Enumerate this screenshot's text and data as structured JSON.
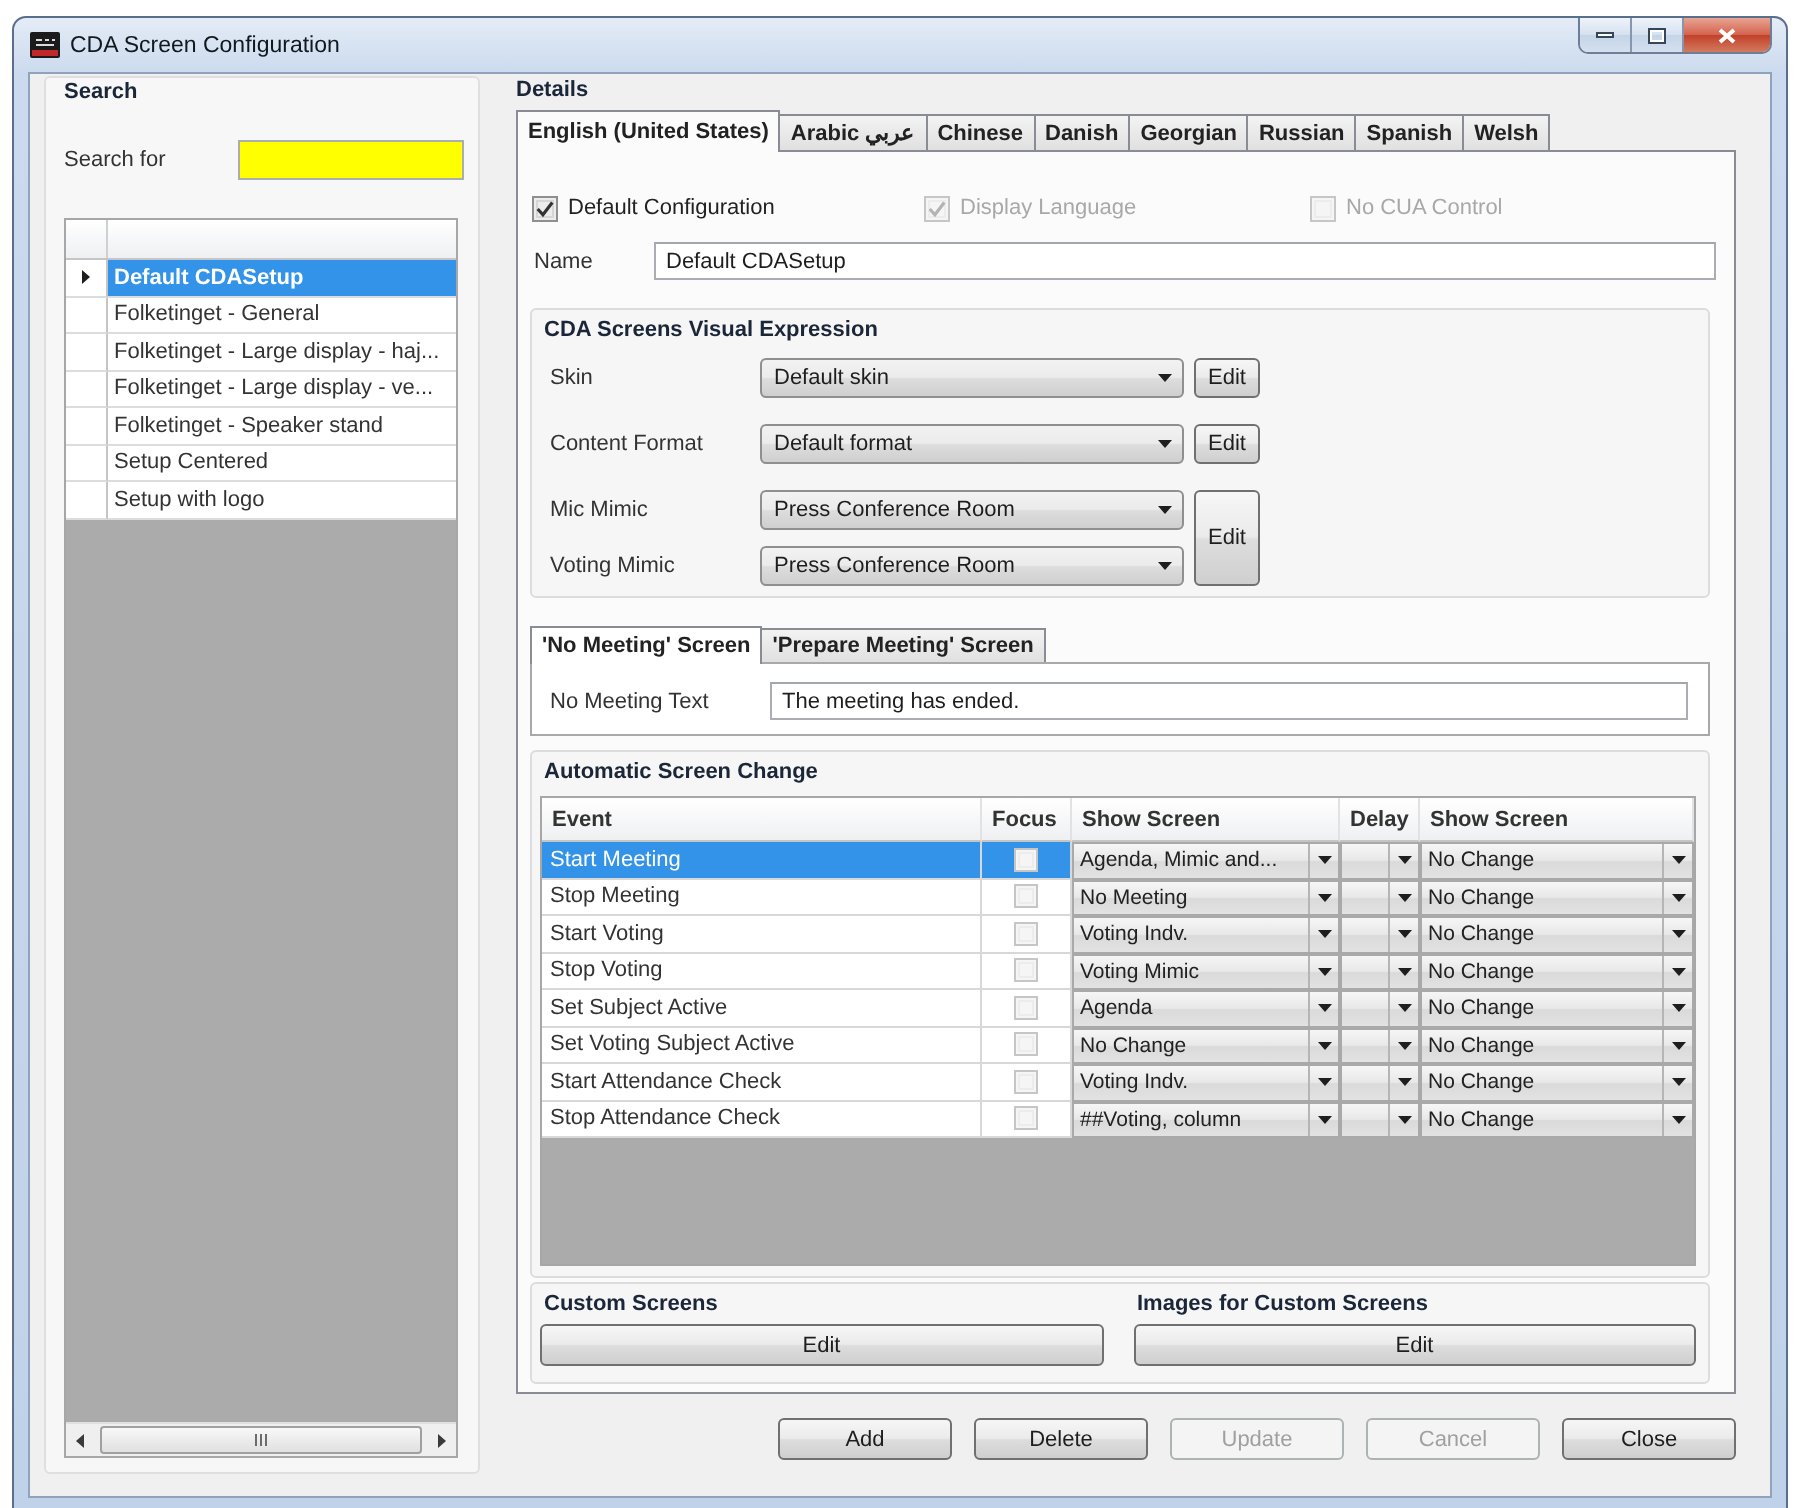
{
  "window": {
    "title": "CDA Screen Configuration"
  },
  "search": {
    "heading": "Search",
    "label": "Search for"
  },
  "setups": [
    {
      "name": "Default CDASetup",
      "selected": true
    },
    {
      "name": "Folketinget - General",
      "selected": false
    },
    {
      "name": "Folketinget - Large display - haj...",
      "selected": false
    },
    {
      "name": "Folketinget - Large display - ve...",
      "selected": false
    },
    {
      "name": "Folketinget - Speaker stand",
      "selected": false
    },
    {
      "name": "Setup Centered",
      "selected": false
    },
    {
      "name": "Setup with logo",
      "selected": false
    }
  ],
  "details": {
    "heading": "Details",
    "tabs": [
      {
        "label": "English (United States)",
        "selected": true
      },
      {
        "label": "Arabic عربي",
        "selected": false
      },
      {
        "label": "Chinese",
        "selected": false
      },
      {
        "label": "Danish",
        "selected": false
      },
      {
        "label": "Georgian",
        "selected": false
      },
      {
        "label": "Russian",
        "selected": false
      },
      {
        "label": "Spanish",
        "selected": false
      },
      {
        "label": "Welsh",
        "selected": false
      }
    ],
    "options": [
      {
        "label": "Default Configuration",
        "checked": true,
        "disabled": false
      },
      {
        "label": "Display Language",
        "checked": true,
        "disabled": true
      },
      {
        "label": "No CUA Control",
        "checked": false,
        "disabled": true
      }
    ],
    "name": {
      "label": "Name",
      "value": "Default CDASetup"
    },
    "visual_expression": {
      "heading": "CDA Screens Visual Expression",
      "groups": [
        {
          "fields": [
            {
              "label": "Skin",
              "value": "Default skin"
            }
          ],
          "button": "Edit"
        },
        {
          "fields": [
            {
              "label": "Content Format",
              "value": "Default format"
            }
          ],
          "button": "Edit"
        },
        {
          "fields": [
            {
              "label": "Mic Mimic",
              "value": "Press Conference Room"
            },
            {
              "label": "Voting Mimic",
              "value": "Press Conference Room"
            }
          ],
          "button": "Edit"
        }
      ]
    },
    "screen_tabs": [
      {
        "label": "'No Meeting' Screen",
        "selected": true
      },
      {
        "label": "'Prepare Meeting' Screen",
        "selected": false
      }
    ],
    "no_meeting_text": {
      "label": "No Meeting Text",
      "value": "The meeting has ended."
    },
    "automatic_screen_change": {
      "heading": "Automatic Screen Change",
      "columns": [
        "Event",
        "Focus",
        "Show Screen",
        "Delay",
        "Show Screen"
      ],
      "rows": [
        {
          "event": "Start Meeting",
          "focus": false,
          "show_screen": "Agenda, Mimic and...",
          "show_screen_2": "No Change",
          "selected": true
        },
        {
          "event": "Stop Meeting",
          "focus": false,
          "show_screen": "No Meeting",
          "show_screen_2": "No Change",
          "selected": false
        },
        {
          "event": "Start Voting",
          "focus": false,
          "show_screen": "Voting Indv.",
          "show_screen_2": "No Change",
          "selected": false
        },
        {
          "event": "Stop Voting",
          "focus": false,
          "show_screen": "Voting Mimic",
          "show_screen_2": "No Change",
          "selected": false
        },
        {
          "event": "Set Subject Active",
          "focus": false,
          "show_screen": "Agenda",
          "show_screen_2": "No Change",
          "selected": false
        },
        {
          "event": "Set Voting Subject Active",
          "focus": false,
          "show_screen": "No Change",
          "show_screen_2": "No Change",
          "selected": false
        },
        {
          "event": "Start Attendance Check",
          "focus": false,
          "show_screen": "Voting Indv.",
          "show_screen_2": "No Change",
          "selected": false
        },
        {
          "event": "Stop Attendance Check",
          "focus": false,
          "show_screen": "##Voting, column",
          "show_screen_2": "No Change",
          "selected": false
        }
      ]
    },
    "custom_screens": {
      "heading": "Custom Screens",
      "button": "Edit"
    },
    "images_for_custom_screens": {
      "heading": "Images for Custom Screens",
      "button": "Edit"
    }
  },
  "buttons": [
    {
      "label": "Add",
      "disabled": false
    },
    {
      "label": "Delete",
      "disabled": false
    },
    {
      "label": "Update",
      "disabled": true
    },
    {
      "label": "Cancel",
      "disabled": true
    },
    {
      "label": "Close",
      "disabled": false
    }
  ]
}
